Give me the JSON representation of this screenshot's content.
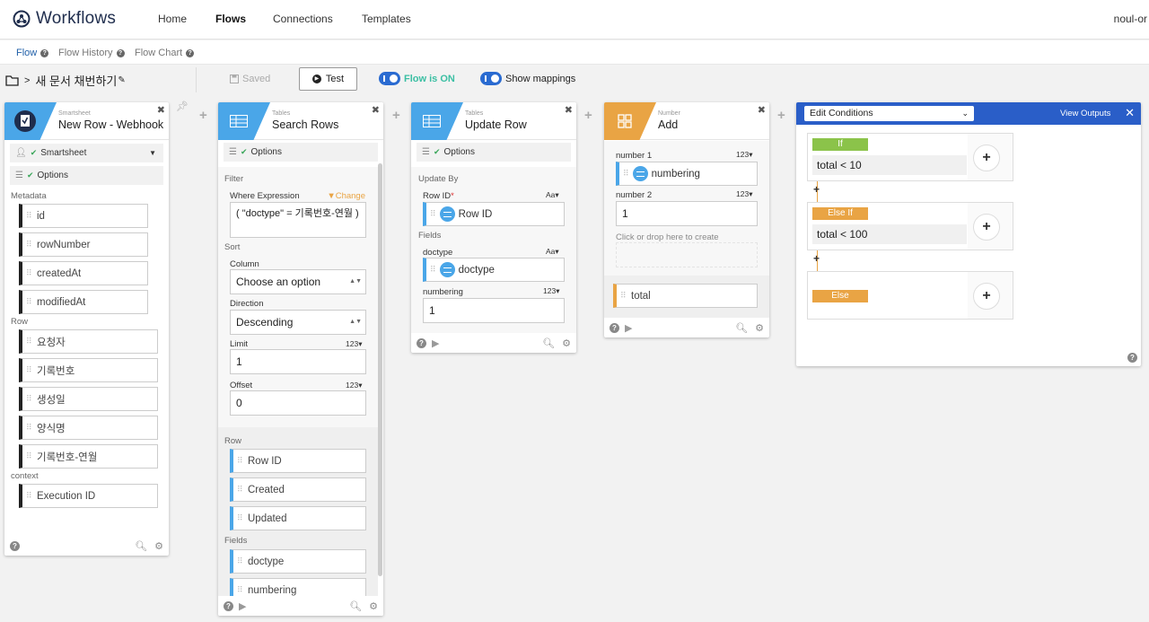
{
  "nav": {
    "brand": "Workflows",
    "items": [
      "Home",
      "Flows",
      "Connections",
      "Templates"
    ],
    "active": "Flows",
    "user": "noul-or"
  },
  "subnav": {
    "items": [
      "Flow",
      "Flow History",
      "Flow Chart"
    ],
    "active": "Flow"
  },
  "toolbar": {
    "flow_name": "새 문서 채번하기",
    "saved_label": "Saved",
    "test_label": "Test",
    "flow_on_label": "Flow is ON",
    "mappings_label": "Show mappings"
  },
  "card1": {
    "service": "Smartsheet",
    "title": "New Row - Webhook",
    "account": "Smartsheet",
    "options": "Options",
    "metadata_label": "Metadata",
    "metadata": [
      "id",
      "rowNumber",
      "createdAt",
      "modifiedAt"
    ],
    "row_label": "Row",
    "row": [
      "요청자",
      "기록번호",
      "생성일",
      "양식명",
      "기록번호-연월"
    ],
    "context_label": "context",
    "context": [
      "Execution ID"
    ]
  },
  "card2": {
    "service": "Tables",
    "title": "Search Rows",
    "options": "Options",
    "filter_label": "Filter",
    "where_label": "Where Expression",
    "change_label": "Change",
    "where_value": "( \"doctype\" = 기록번호-연월 )",
    "sort_label": "Sort",
    "column_label": "Column",
    "column_value": "Choose an option",
    "direction_label": "Direction",
    "direction_value": "Descending",
    "limit_label": "Limit",
    "limit_type": "123",
    "limit_value": "1",
    "offset_label": "Offset",
    "offset_type": "123",
    "offset_value": "0",
    "row_label": "Row",
    "row": [
      "Row ID",
      "Created",
      "Updated"
    ],
    "fields_label": "Fields",
    "fields": [
      "doctype",
      "numbering"
    ]
  },
  "card3": {
    "service": "Tables",
    "title": "Update Row",
    "options": "Options",
    "update_by_label": "Update By",
    "rowid_label": "Row ID",
    "rowid_required": "*",
    "rowid_type": "Aa",
    "rowid_value": "Row ID",
    "fields_label": "Fields",
    "doctype_label": "doctype",
    "doctype_type": "Aa",
    "doctype_value": "doctype",
    "numbering_label": "numbering",
    "numbering_type": "123",
    "numbering_value": "1"
  },
  "card4": {
    "service": "Number",
    "title": "Add",
    "n1_label": "number 1",
    "n1_type": "123",
    "n1_value": "numbering",
    "n2_label": "number 2",
    "n2_type": "123",
    "n2_value": "1",
    "drop_hint": "Click or drop here to create",
    "output": "total"
  },
  "card5": {
    "mode": "Edit Conditions",
    "view_outputs": "View Outputs",
    "conditions": [
      {
        "tag": "If",
        "expr": "total < 10",
        "color": "#8bc34a"
      },
      {
        "tag": "Else If",
        "expr": "total < 100",
        "color": "#e9a444"
      },
      {
        "tag": "Else",
        "expr": "",
        "color": "#e9a444"
      }
    ]
  },
  "colors": {
    "tables": "#4aa6e8",
    "number": "#e9a444",
    "smartsheet": "#1f2d4d",
    "conditions_head": "#2a5ec8"
  }
}
